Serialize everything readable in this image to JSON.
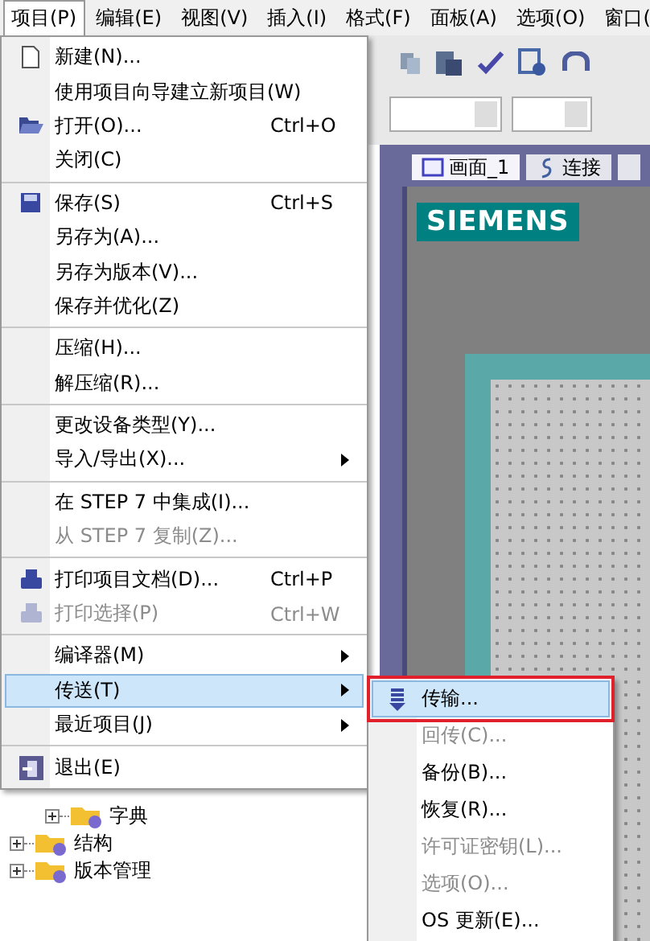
{
  "menubar": [
    {
      "label": "项目(P)",
      "selected": true
    },
    {
      "label": "编辑(E)",
      "selected": false
    },
    {
      "label": "视图(V)",
      "selected": false
    },
    {
      "label": "插入(I)",
      "selected": false
    },
    {
      "label": "格式(F)",
      "selected": false
    },
    {
      "label": "面板(A)",
      "selected": false
    },
    {
      "label": "选项(O)",
      "selected": false
    },
    {
      "label": "窗口(",
      "selected": false
    }
  ],
  "editor_tabs": [
    {
      "label": "画面_1",
      "selected": true
    },
    {
      "label": "连接",
      "selected": false
    }
  ],
  "logo": {
    "text": "SIEMENS"
  },
  "tree": [
    {
      "label": "字典",
      "expanded": false
    },
    {
      "label": "结构",
      "expanded": false
    },
    {
      "label": "版本管理",
      "expanded": false
    }
  ],
  "project_menu": {
    "groups": [
      [
        {
          "label": "新建(N)...",
          "disabled": false,
          "submenu": false,
          "selected": false
        },
        {
          "label": "使用项目向导建立新项目(W)",
          "disabled": false,
          "submenu": false,
          "selected": false
        },
        {
          "label": "打开(O)...",
          "shortcut": "Ctrl+O",
          "disabled": false,
          "submenu": false,
          "selected": false
        },
        {
          "label": "关闭(C)",
          "disabled": false,
          "submenu": false,
          "selected": false
        }
      ],
      [
        {
          "label": "保存(S)",
          "shortcut": "Ctrl+S",
          "disabled": false,
          "submenu": false,
          "selected": false
        },
        {
          "label": "另存为(A)...",
          "disabled": false,
          "submenu": false,
          "selected": false
        },
        {
          "label": "另存为版本(V)...",
          "disabled": false,
          "submenu": false,
          "selected": false
        },
        {
          "label": "保存并优化(Z)",
          "disabled": false,
          "submenu": false,
          "selected": false
        }
      ],
      [
        {
          "label": "压缩(H)...",
          "disabled": false,
          "submenu": false,
          "selected": false
        },
        {
          "label": "解压缩(R)...",
          "disabled": false,
          "submenu": false,
          "selected": false
        }
      ],
      [
        {
          "label": "更改设备类型(Y)...",
          "disabled": false,
          "submenu": false,
          "selected": false
        },
        {
          "label": "导入/导出(X)...",
          "disabled": false,
          "submenu": true,
          "selected": false
        }
      ],
      [
        {
          "label": "在 STEP 7 中集成(I)...",
          "disabled": false,
          "submenu": false,
          "selected": false
        },
        {
          "label": "从 STEP 7 复制(Z)...",
          "disabled": true,
          "submenu": false,
          "selected": false
        }
      ],
      [
        {
          "label": "打印项目文档(D)...",
          "shortcut": "Ctrl+P",
          "disabled": false,
          "submenu": false,
          "selected": false
        },
        {
          "label": "打印选择(P)",
          "shortcut": "Ctrl+W",
          "disabled": true,
          "submenu": false,
          "selected": false
        }
      ],
      [
        {
          "label": "编译器(M)",
          "disabled": false,
          "submenu": true,
          "selected": false
        },
        {
          "label": "传送(T)",
          "disabled": false,
          "submenu": true,
          "selected": true
        },
        {
          "label": "最近项目(J)",
          "disabled": false,
          "submenu": true,
          "selected": false
        }
      ],
      [
        {
          "label": "退出(E)",
          "disabled": false,
          "submenu": false,
          "selected": false
        }
      ]
    ]
  },
  "transfer_submenu": [
    {
      "label": "传输...",
      "disabled": false,
      "selected": true,
      "marked": true
    },
    {
      "label": "回传(C)...",
      "disabled": true,
      "selected": false,
      "marked": false
    },
    {
      "label": "备份(B)...",
      "disabled": false,
      "selected": false,
      "marked": false
    },
    {
      "label": "恢复(R)...",
      "disabled": false,
      "selected": false,
      "marked": false
    },
    {
      "label": "许可证密钥(L)...",
      "disabled": true,
      "selected": false,
      "marked": false
    },
    {
      "label": "选项(O)...",
      "disabled": true,
      "selected": false,
      "marked": false
    },
    {
      "label": "OS 更新(E)...",
      "disabled": false,
      "selected": false,
      "marked": false
    }
  ]
}
